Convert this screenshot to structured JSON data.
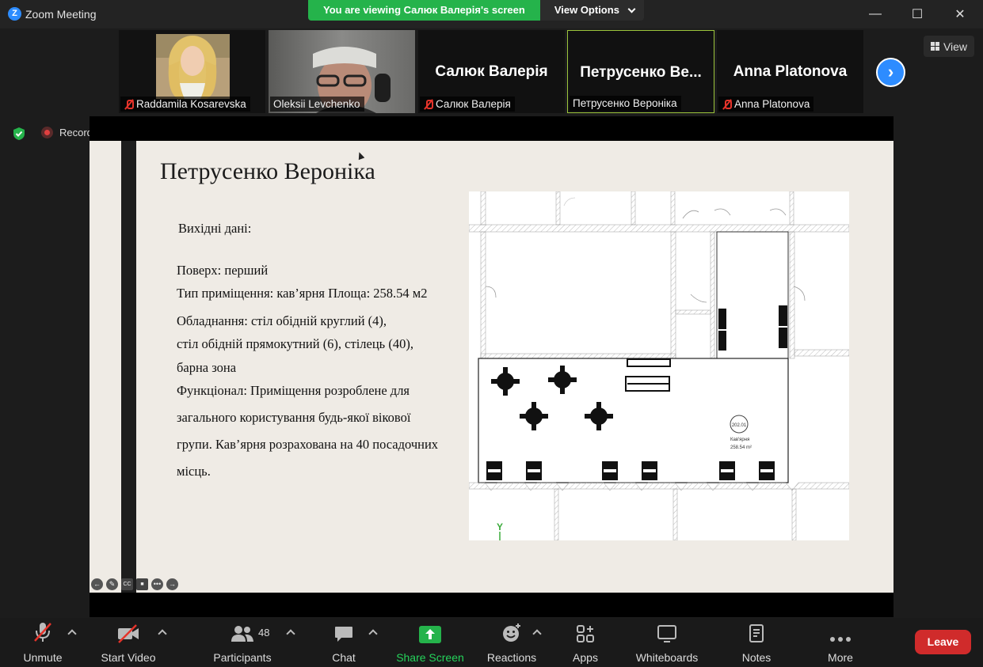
{
  "window": {
    "title": "Zoom Meeting",
    "logo_letter": "Z",
    "controls": {
      "minimize": "—",
      "maximize": "☐",
      "close": "✕"
    }
  },
  "banner": {
    "viewing_text": "You are viewing Салюк Валерія's screen",
    "view_options_label": "View Options"
  },
  "participants": [
    {
      "name": "Raddamila Kosarevska",
      "muted": true,
      "video": true
    },
    {
      "name": "Oleksii Levchenko",
      "muted": false,
      "video": true
    },
    {
      "name": "Салюк Валерія",
      "display": "Салюк Валерія",
      "muted": true,
      "video": false
    },
    {
      "name": "Петрусенко Вероніка",
      "display": "Петрусенко  Ве...",
      "muted": false,
      "video": false,
      "active_speaker": true
    },
    {
      "name": "Anna Platonova",
      "display": "Anna Platonova",
      "muted": true,
      "video": false
    }
  ],
  "view_button_label": "View",
  "recording_label": "Recording",
  "slide": {
    "title": "Петрусенко Вероніка",
    "input_heading": "Вихідні дані:",
    "lines": [
      "Поверх: перший",
      "Тип приміщення: кав’ярня Площа: 258.54 м2",
      "Обладнання: стіл обідній круглий (4),",
      "стіл обідній прямокутний (6), стілець (40),",
      "барна зона",
      "Функціонал: Приміщення розроблене для",
      "загального користування будь-якої вікової",
      "групи. Кав’ярня розрахована на 40 посадочних",
      "місць."
    ],
    "plan": {
      "room_number": "202.01",
      "room_name": "Кав'ярня",
      "room_area": "258.54 m²",
      "axis_label": "Y"
    },
    "tools": [
      "←",
      "✎",
      "CC",
      "■",
      "•••",
      "→"
    ]
  },
  "toolbar": {
    "unmute": "Unmute",
    "start_video": "Start Video",
    "participants": "Participants",
    "participants_count": "48",
    "chat": "Chat",
    "share_screen": "Share Screen",
    "reactions": "Reactions",
    "apps": "Apps",
    "whiteboards": "Whiteboards",
    "notes": "Notes",
    "more": "More",
    "leave": "Leave"
  },
  "colors": {
    "zoom_blue": "#2d8cff",
    "share_green": "#25b34b",
    "leave_red": "#d02b2b",
    "active_speaker": "#9cc53c"
  }
}
